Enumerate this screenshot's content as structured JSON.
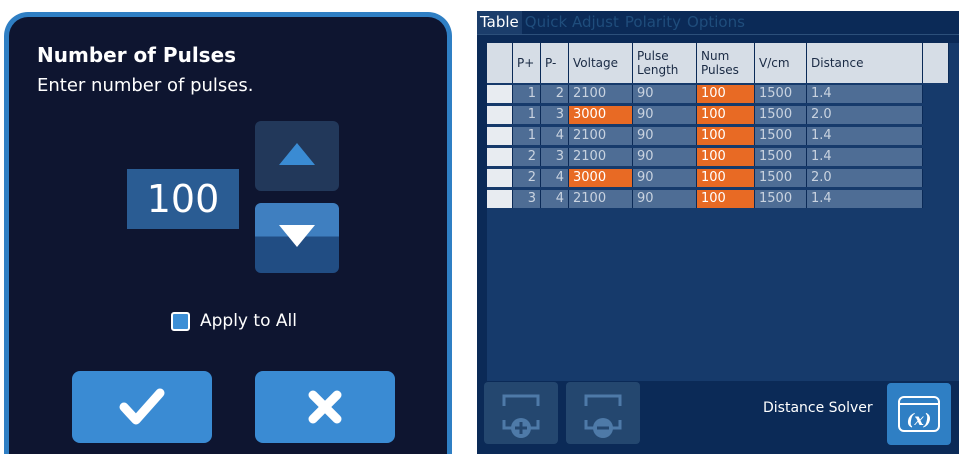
{
  "dialog": {
    "title": "Number of Pulses",
    "subtitle": "Enter number of pulses.",
    "value": "100",
    "up_icon": "triangle-up-icon",
    "down_icon": "triangle-down-icon",
    "apply_all_label": "Apply to All",
    "apply_all_checked": true,
    "confirm_icon": "checkmark-icon",
    "cancel_icon": "close-icon"
  },
  "table_panel": {
    "tabs": [
      "Table",
      "Quick Adjust",
      "Polarity",
      "Options"
    ],
    "active_tab": "Table",
    "headers": [
      "",
      "P+",
      "P-",
      "Voltage",
      "Pulse Length",
      "Num Pulses",
      "V/cm",
      "Distance",
      ""
    ],
    "rows": [
      {
        "p_plus": "1",
        "p_minus": "2",
        "voltage": "2100",
        "pulse_length": "90",
        "num_pulses": "100",
        "v_cm": "1500",
        "distance": "1.4",
        "voltage_highlight": false
      },
      {
        "p_plus": "1",
        "p_minus": "3",
        "voltage": "3000",
        "pulse_length": "90",
        "num_pulses": "100",
        "v_cm": "1500",
        "distance": "2.0",
        "voltage_highlight": true
      },
      {
        "p_plus": "1",
        "p_minus": "4",
        "voltage": "2100",
        "pulse_length": "90",
        "num_pulses": "100",
        "v_cm": "1500",
        "distance": "1.4",
        "voltage_highlight": false
      },
      {
        "p_plus": "2",
        "p_minus": "3",
        "voltage": "2100",
        "pulse_length": "90",
        "num_pulses": "100",
        "v_cm": "1500",
        "distance": "1.4",
        "voltage_highlight": false
      },
      {
        "p_plus": "2",
        "p_minus": "4",
        "voltage": "3000",
        "pulse_length": "90",
        "num_pulses": "100",
        "v_cm": "1500",
        "distance": "2.0",
        "voltage_highlight": true
      },
      {
        "p_plus": "3",
        "p_minus": "4",
        "voltage": "2100",
        "pulse_length": "90",
        "num_pulses": "100",
        "v_cm": "1500",
        "distance": "1.4",
        "voltage_highlight": false
      }
    ],
    "highlight_color": "#e86a24",
    "add_icon": "add-row-icon",
    "remove_icon": "remove-row-icon",
    "solver_label": "Distance Solver",
    "solver_icon_text": "(x)"
  }
}
